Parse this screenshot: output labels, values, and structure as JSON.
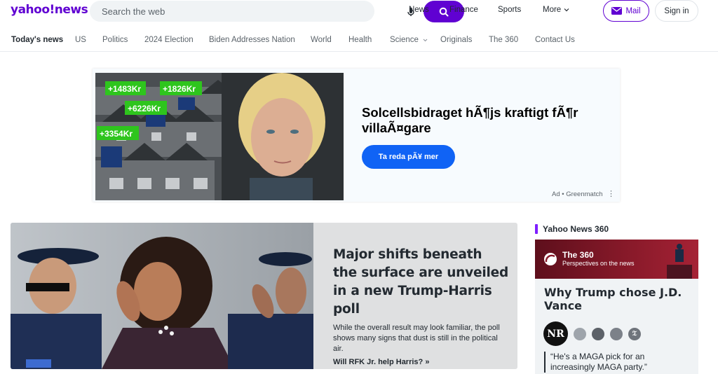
{
  "header": {
    "logo": "yahoo!news",
    "search_placeholder": "Search the web",
    "nav": [
      "News",
      "Finance",
      "Sports",
      "More"
    ],
    "mail_label": "Mail",
    "signin_label": "Sign in",
    "brand_color": "#6001d2"
  },
  "subnav": {
    "items": [
      "Today's news",
      "US",
      "Politics",
      "2024 Election",
      "Biden Addresses Nation",
      "World",
      "Health",
      "Science",
      "Originals",
      "The 360",
      "Contact Us"
    ],
    "active": "Today's news"
  },
  "ad": {
    "title": "Solcellsbidraget hÃ¶js kraftigt fÃ¶r villaÃ¤gare",
    "cta": "Ta reda pÃ¥ mer",
    "sponsor": "Ad • Greenmatch",
    "price_tags": [
      "+1483Kr",
      "+1826Kr",
      "+6226Kr",
      "+3354Kr"
    ],
    "cta_color": "#1063f5"
  },
  "hero": {
    "title": "Major shifts beneath the surface are unveiled in a new Trump-Harris poll",
    "description": "While the overall result may look familiar, the poll shows many signs that dust is still in the political air.",
    "related_link": "Will RFK Jr. help Harris? »"
  },
  "sidebar": {
    "section_title": "Yahoo News 360",
    "banner_title": "The 360",
    "banner_subtitle": "Perspectives on the news",
    "card_title": "Why Trump chose J.D. Vance",
    "source_badge": "NR",
    "quote": "“He's a MAGA pick for an increasingly MAGA party.”",
    "accent_color": "#7e1fff"
  }
}
